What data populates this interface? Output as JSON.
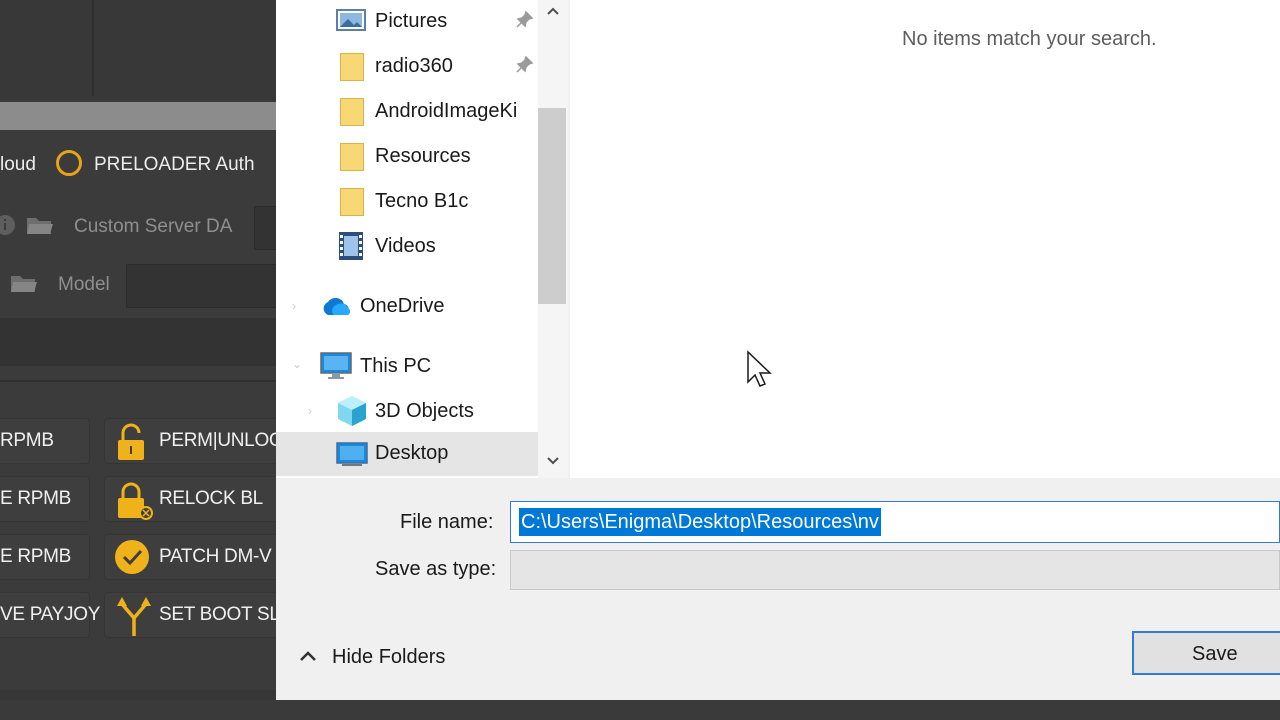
{
  "background_app": {
    "radio_left_fragment": "loud",
    "radio_preloader": "PRELOADER Auth",
    "custom_server_label": "Custom Server DA",
    "model_label": "Model",
    "buttons_left": [
      "RPMB",
      "E RPMB",
      "E RPMB",
      "VE PAYJOY"
    ],
    "buttons_right": [
      "PERM|UNLOC",
      "RELOCK BL",
      "PATCH DM-V",
      "SET BOOT SL"
    ],
    "accent_color": "#e8a317"
  },
  "dialog": {
    "nav": {
      "items": [
        {
          "label": "Pictures",
          "icon": "pictures-icon",
          "pinned": true
        },
        {
          "label": "radio360",
          "icon": "folder-icon",
          "pinned": true
        },
        {
          "label": "AndroidImageKi",
          "icon": "folder-icon",
          "pinned": false
        },
        {
          "label": "Resources",
          "icon": "folder-icon",
          "pinned": false
        },
        {
          "label": "Tecno B1c",
          "icon": "folder-icon",
          "pinned": false
        },
        {
          "label": "Videos",
          "icon": "videos-icon",
          "pinned": false
        },
        {
          "label": "OneDrive",
          "icon": "onedrive-icon",
          "pinned": false
        },
        {
          "label": "This PC",
          "icon": "this-pc-icon",
          "pinned": false
        },
        {
          "label": "3D Objects",
          "icon": "3d-objects-icon",
          "pinned": false
        },
        {
          "label": "Desktop",
          "icon": "desktop-icon",
          "pinned": false,
          "selected": true
        }
      ]
    },
    "empty_message": "No items match your search.",
    "file_name_label": "File name:",
    "file_name_value": "C:\\Users\\Enigma\\Desktop\\Resources\\nv",
    "save_as_type_label": "Save as type:",
    "save_as_type_value": "",
    "hide_folders_label": "Hide Folders",
    "save_label": "Save",
    "selection_color": "#0078d7"
  }
}
